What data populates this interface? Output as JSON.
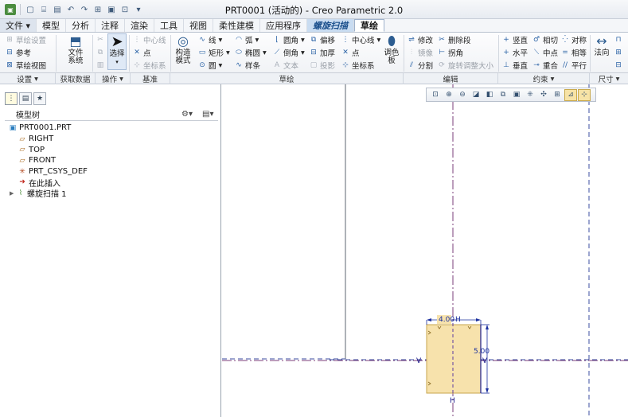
{
  "window": {
    "title": "PRT0001 (活动的) - Creo Parametric 2.0",
    "quick_access": [
      "app-icon",
      "new-icon",
      "open-icon",
      "save-icon",
      "undo-icon",
      "redo-icon",
      "regenerate-icon",
      "window-icon",
      "close-window-icon",
      "customize-icon"
    ]
  },
  "menu": {
    "file": "文件",
    "tabs": [
      "模型",
      "分析",
      "注释",
      "渲染",
      "工具",
      "视图",
      "柔性建模",
      "应用程序"
    ],
    "context_tab": "螺旋扫描",
    "active_tab": "草绘"
  },
  "ribbon": {
    "setup": {
      "sketch_setup": "草绘设置",
      "reference": "参考",
      "sketch_view": "草绘视图"
    },
    "get_data": {
      "file_system": [
        "文件",
        "系统"
      ]
    },
    "operations": {
      "select": "选择"
    },
    "datum": {
      "centerline": "中心线",
      "point": "点",
      "coord_sys": "坐标系"
    },
    "sketch": {
      "construction": [
        "构造",
        "模式"
      ],
      "line": "线",
      "rectangle": "矩形",
      "circle": "圆",
      "arc": "弧",
      "ellipse": "椭圆",
      "spline": "样条",
      "fillet": "圆角",
      "chamfer": "倒角",
      "text": "文本",
      "offset": "偏移",
      "thicken": "加厚",
      "project": "投影",
      "centerline": "中心线",
      "point": "点",
      "coord_sys": "坐标系"
    },
    "palette": [
      "调色",
      "板"
    ],
    "editing": {
      "modify": "修改",
      "delete_segment": "删除段",
      "mirror": "镜像",
      "corner": "拐角",
      "divide": "分割",
      "rotate_resize": "旋转调整大小"
    },
    "constrain": {
      "vertical": "竖直",
      "tangent": "相切",
      "symmetric": "对称",
      "horizontal": "水平",
      "midpoint": "中点",
      "equal": "相等",
      "perpendicular": "垂直",
      "coincident": "重合",
      "parallel": "平行"
    },
    "dimension": {
      "normal": "法向"
    }
  },
  "groups": [
    {
      "label": "设置",
      "dropdown": true
    },
    {
      "label": "获取数据",
      "dropdown": false
    },
    {
      "label": "操作",
      "dropdown": true
    },
    {
      "label": "基准",
      "dropdown": false
    },
    {
      "label": "草绘",
      "dropdown": false
    },
    {
      "label": "编辑",
      "dropdown": false
    },
    {
      "label": "约束",
      "dropdown": true
    },
    {
      "label": "尺寸",
      "dropdown": true
    }
  ],
  "model_tree": {
    "header": "模型树",
    "items": [
      {
        "label": "PRT0001.PRT",
        "icon": "part-icon"
      },
      {
        "label": "RIGHT",
        "icon": "datum-plane-icon"
      },
      {
        "label": "TOP",
        "icon": "datum-plane-icon"
      },
      {
        "label": "FRONT",
        "icon": "datum-plane-icon"
      },
      {
        "label": "PRT_CSYS_DEF",
        "icon": "coordinate-system-icon"
      },
      {
        "label": "在此插入",
        "icon": "insert-here-icon"
      },
      {
        "label": "螺旋扫描 1",
        "icon": "helical-sweep-icon"
      }
    ]
  },
  "sketch": {
    "dim_width": "4.00",
    "dim_height": "5.00",
    "constraint_h": "H",
    "constraint_v": "V",
    "fill_color": "#f7e2ac",
    "edge_color": "#1a1a8a",
    "centerline_color": "#9a3d9a",
    "dimension_color": "#1a2f9e"
  }
}
